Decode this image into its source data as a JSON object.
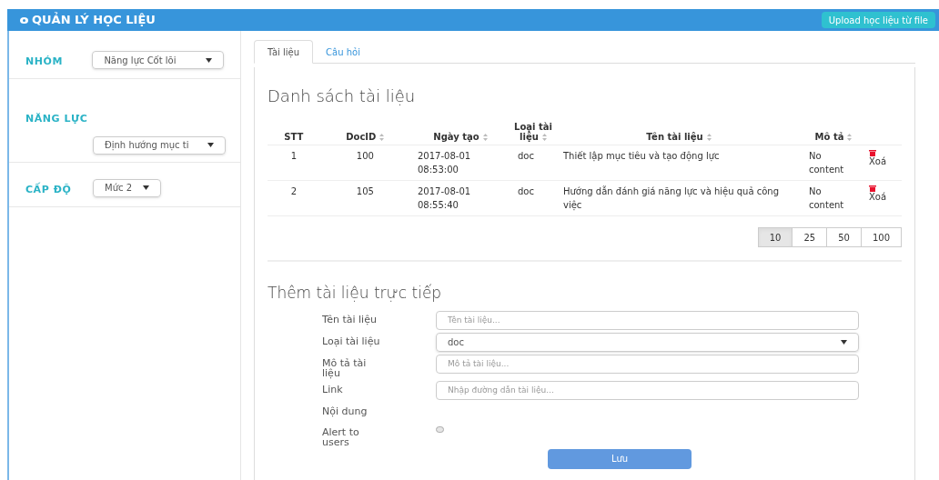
{
  "header": {
    "title": "QUẢN LÝ HỌC LIỆU",
    "upload_button": "Upload học liệu từ file"
  },
  "sidebar": {
    "filters": [
      {
        "label": "NHÓM",
        "value": "Năng lực Cốt lõi",
        "kind": "inline"
      },
      {
        "label": "NĂNG LỰC",
        "value": "Định hướng mục ti",
        "kind": "stacked"
      },
      {
        "label": "CẤP ĐỘ",
        "value": "Mức 2",
        "kind": "inline"
      }
    ]
  },
  "tabs": [
    {
      "label": "Tài liệu",
      "selected": true
    },
    {
      "label": "Câu hỏi",
      "selected": false
    }
  ],
  "list": {
    "title": "Danh sách tài liệu",
    "columns": [
      {
        "label": "STT",
        "sortable": false
      },
      {
        "label": "DocID",
        "sortable": true
      },
      {
        "label": "Ngày tạo",
        "sortable": true
      },
      {
        "label": "Loại tài liệu",
        "sortable": true
      },
      {
        "label": "Tên tài liệu",
        "sortable": true
      },
      {
        "label": "Mô tả",
        "sortable": true
      }
    ],
    "rows": [
      {
        "stt": "1",
        "doc_id": "100",
        "created": "2017-08-01 08:53:00",
        "type": "doc",
        "name": "Thiết lập mục tiêu và tạo động lực",
        "description": "No content",
        "delete": "Xoá"
      },
      {
        "stt": "2",
        "doc_id": "105",
        "created": "2017-08-01 08:55:40",
        "type": "doc",
        "name": "Hướng dẫn đánh giá năng lực và hiệu quả công việc",
        "description": "No content",
        "delete": "Xoá"
      }
    ],
    "page_sizes": [
      {
        "label": "10",
        "selected": true
      },
      {
        "label": "25",
        "selected": false
      },
      {
        "label": "50",
        "selected": false
      },
      {
        "label": "100",
        "selected": false
      }
    ]
  },
  "form": {
    "title": "Thêm tài liệu trực tiếp",
    "fields": [
      {
        "kind": "text",
        "label": "Tên tài liệu",
        "placeholder": "Tên tài liệu..."
      },
      {
        "kind": "select",
        "label": "Loại tài liệu",
        "value": "doc"
      },
      {
        "kind": "text",
        "label": "Mô tả tài liệu",
        "placeholder": "Mô tả tài liệu..."
      },
      {
        "kind": "text",
        "label": "Link",
        "placeholder": "Nhập đường dẫn tài liệu..."
      },
      {
        "kind": "none",
        "label": "Nội dung"
      },
      {
        "kind": "checkbox",
        "label": "Alert to users",
        "checked": false
      }
    ],
    "save_button": "Lưu"
  }
}
